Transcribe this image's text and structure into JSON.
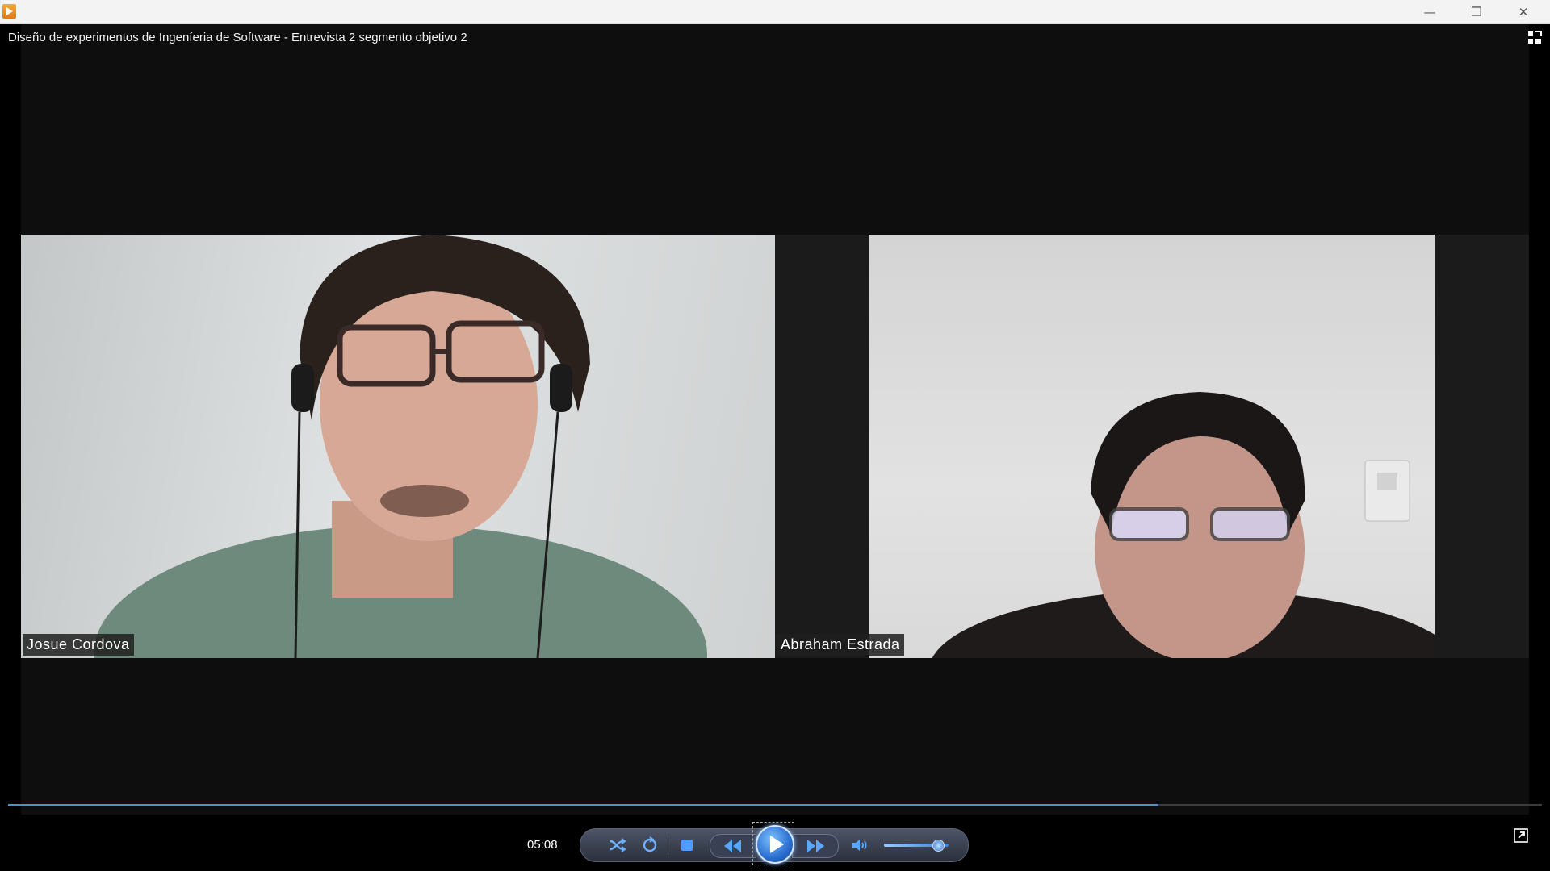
{
  "window": {
    "title": "Diseño de experimentos de Ingeníeria de Software - Entrevista 2 segmento objetivo 2",
    "minimize_glyph": "—",
    "maximize_glyph": "❐",
    "close_glyph": "✕"
  },
  "participants": [
    {
      "name": "Josue Cordova"
    },
    {
      "name": "Abraham Estrada"
    }
  ],
  "player": {
    "current_time": "05:08",
    "progress_fraction": 0.75,
    "volume_fraction": 0.82,
    "controls": [
      "shuffle-icon",
      "repeat-icon",
      "stop-icon",
      "previous-icon",
      "play-icon",
      "next-icon",
      "volume-icon"
    ],
    "accent_color": "#4b8fd8"
  }
}
